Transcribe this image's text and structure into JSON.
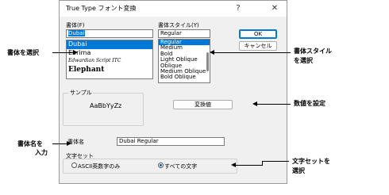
{
  "dialog": {
    "title": "True Type フォント変換",
    "help_glyph": "?",
    "close_glyph": "✕"
  },
  "font": {
    "label": "書体(F)",
    "value": "Dubai",
    "items": [
      "Dubai",
      "Ebrima",
      "Edwardian Script ITC",
      "Elephant"
    ]
  },
  "style": {
    "label": "書体スタイル(Y)",
    "value": "Regular",
    "items": [
      "Regular",
      "Medium",
      "Bold",
      "Light Oblique",
      "Oblique",
      "Medium Oblique",
      "Bold Oblique"
    ]
  },
  "buttons": {
    "ok": "OK",
    "cancel": "キャンセル",
    "convert": "変換値"
  },
  "sample": {
    "label": "サンプル",
    "text": "AaBbYyZz"
  },
  "name": {
    "label": "書体名",
    "value": "Dubai Regular"
  },
  "charset": {
    "label": "文字セット",
    "option_ascii": "ASCII英数字のみ",
    "option_all": "すべての文字",
    "selected": "すべての文字"
  },
  "annotations": {
    "select_font": "書体を選択",
    "select_style_1": "書体スタイル",
    "select_style_2": "を選択",
    "set_value": "数値を設定",
    "enter_name_1": "書体名を",
    "enter_name_2": "入力",
    "select_charset_1": "文字セットを",
    "select_charset_2": "選択"
  }
}
